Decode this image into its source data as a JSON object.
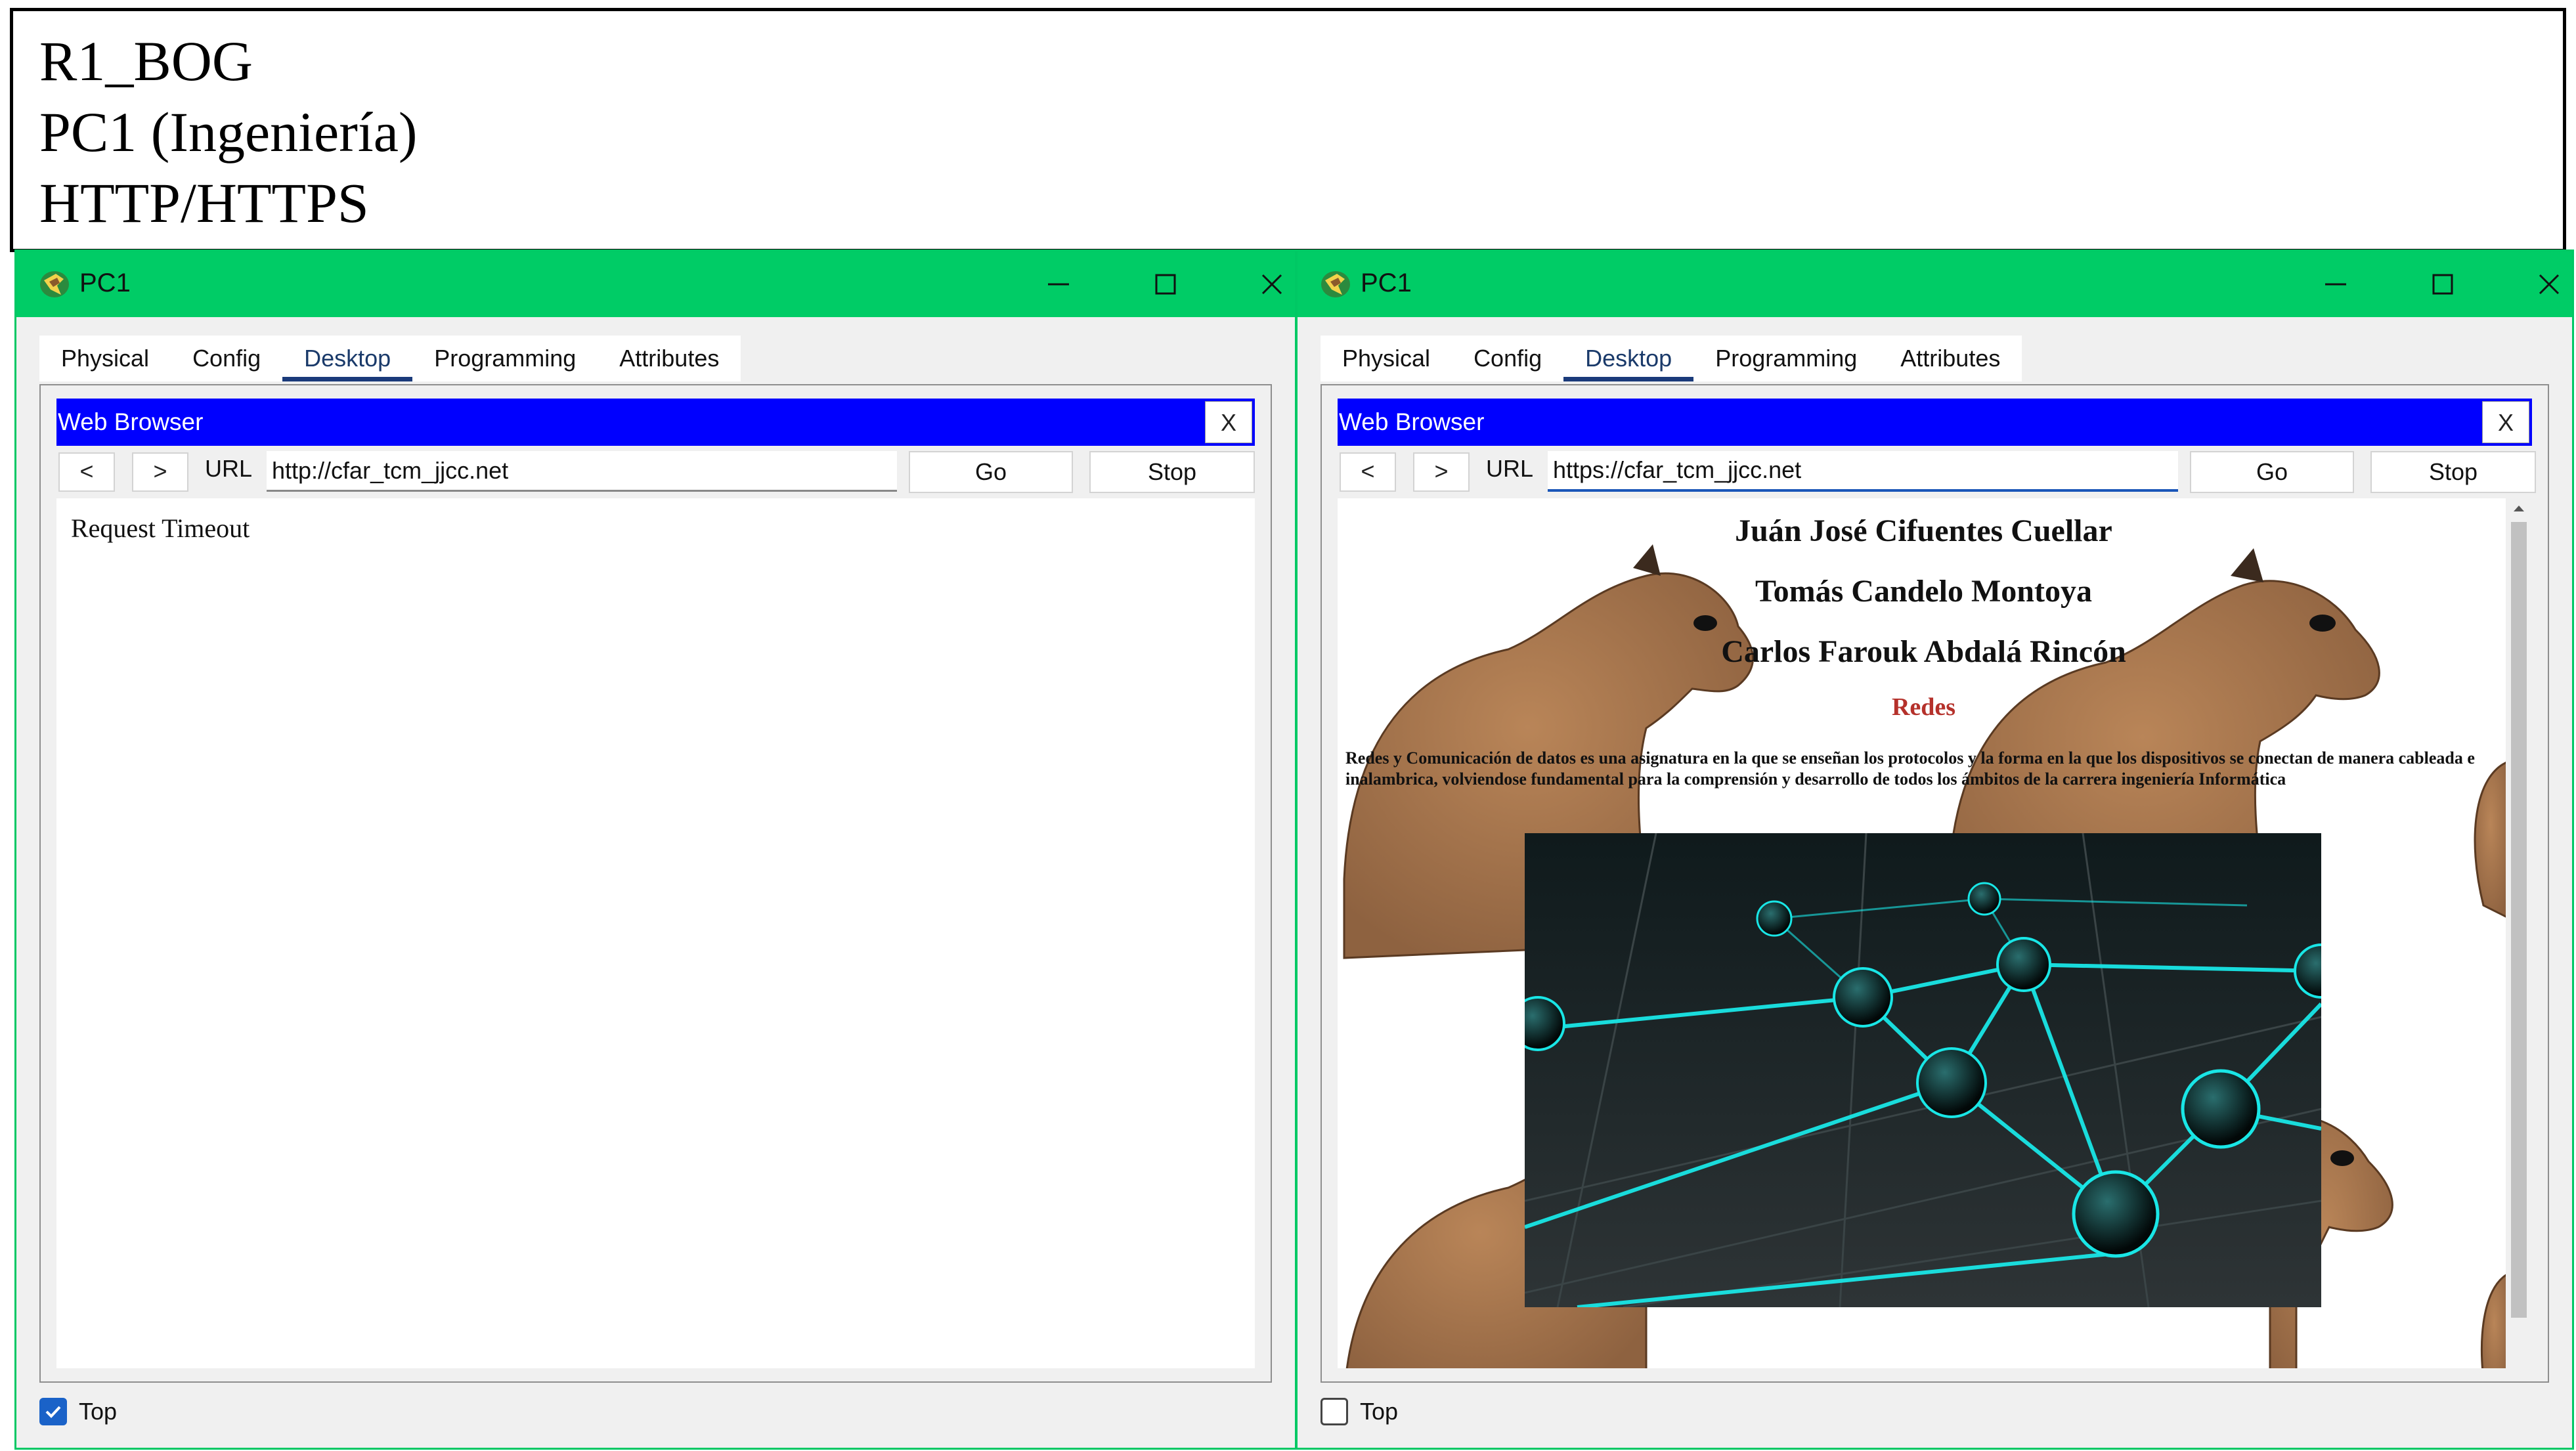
{
  "header": {
    "line1": "R1_BOG",
    "line2": "PC1 (Ingeniería)",
    "line3": "HTTP/HTTPS"
  },
  "windows": [
    {
      "title": "PC1",
      "tabs": [
        "Physical",
        "Config",
        "Desktop",
        "Programming",
        "Attributes"
      ],
      "active_tab": "Desktop",
      "browser": {
        "title": "Web Browser",
        "close_label": "X",
        "back_label": "<",
        "forward_label": ">",
        "url_label": "URL",
        "url_value": "http://cfar_tcm_jjcc.net",
        "go_label": "Go",
        "stop_label": "Stop",
        "message": "Request Timeout"
      },
      "footer": {
        "top_label": "Top",
        "top_checked": true
      }
    },
    {
      "title": "PC1",
      "tabs": [
        "Physical",
        "Config",
        "Desktop",
        "Programming",
        "Attributes"
      ],
      "active_tab": "Desktop",
      "browser": {
        "title": "Web Browser",
        "close_label": "X",
        "back_label": "<",
        "forward_label": ">",
        "url_label": "URL",
        "url_value": "https://cfar_tcm_jjcc.net",
        "go_label": "Go",
        "stop_label": "Stop",
        "page": {
          "names": [
            "Juán José Cifuentes Cuellar",
            "Tomás Candelo Montoya",
            "Carlos Farouk Abdalá Rincón"
          ],
          "subject": "Redes",
          "description": "Redes y Comunicación de datos es una asignatura en la que se enseñan los protocolos y la forma en la que los dispositivos se conectan de manera cableada e inalambrica, volviendose fundamental para la comprensión y desarrollo de todos los ámbitos de la carrera ingeniería Informática"
        }
      },
      "footer": {
        "top_label": "Top",
        "top_checked": false
      }
    }
  ],
  "colors": {
    "titlebar": "#00cc66",
    "browser_bar": "#0000ff",
    "subject_text": "#b5312b",
    "network_glow": "#19e6e6"
  }
}
